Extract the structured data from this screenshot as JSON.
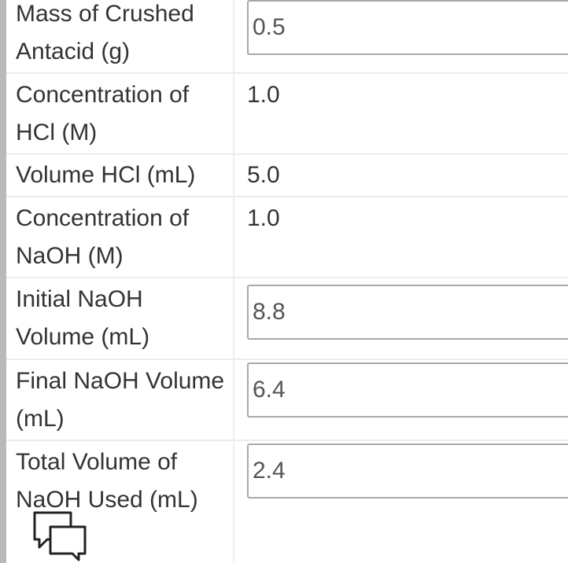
{
  "form": {
    "rows": [
      {
        "label": "Mass of Crushed Antacid (g)",
        "value": "0.5",
        "kind": "input"
      },
      {
        "label": "Concentration of HCl (M)",
        "value": "1.0",
        "kind": "text"
      },
      {
        "label": "Volume HCl (mL)",
        "value": "5.0",
        "kind": "text"
      },
      {
        "label": "Concentration of NaOH (M)",
        "value": "1.0",
        "kind": "text"
      },
      {
        "label": "Initial NaOH Volume (mL)",
        "value": "8.8",
        "kind": "input"
      },
      {
        "label": "Final NaOH Volume (mL)",
        "value": "6.4",
        "kind": "input"
      },
      {
        "label": "Total Volume of NaOH Used (mL)",
        "value": "2.4",
        "kind": "input"
      }
    ]
  },
  "icons": {
    "comment": "comment-bubbles-icon"
  },
  "colors": {
    "text": "#333333",
    "input_border": "#a9a9a9",
    "row_divider": "#ececec",
    "left_strip": "#b9b9b9"
  }
}
